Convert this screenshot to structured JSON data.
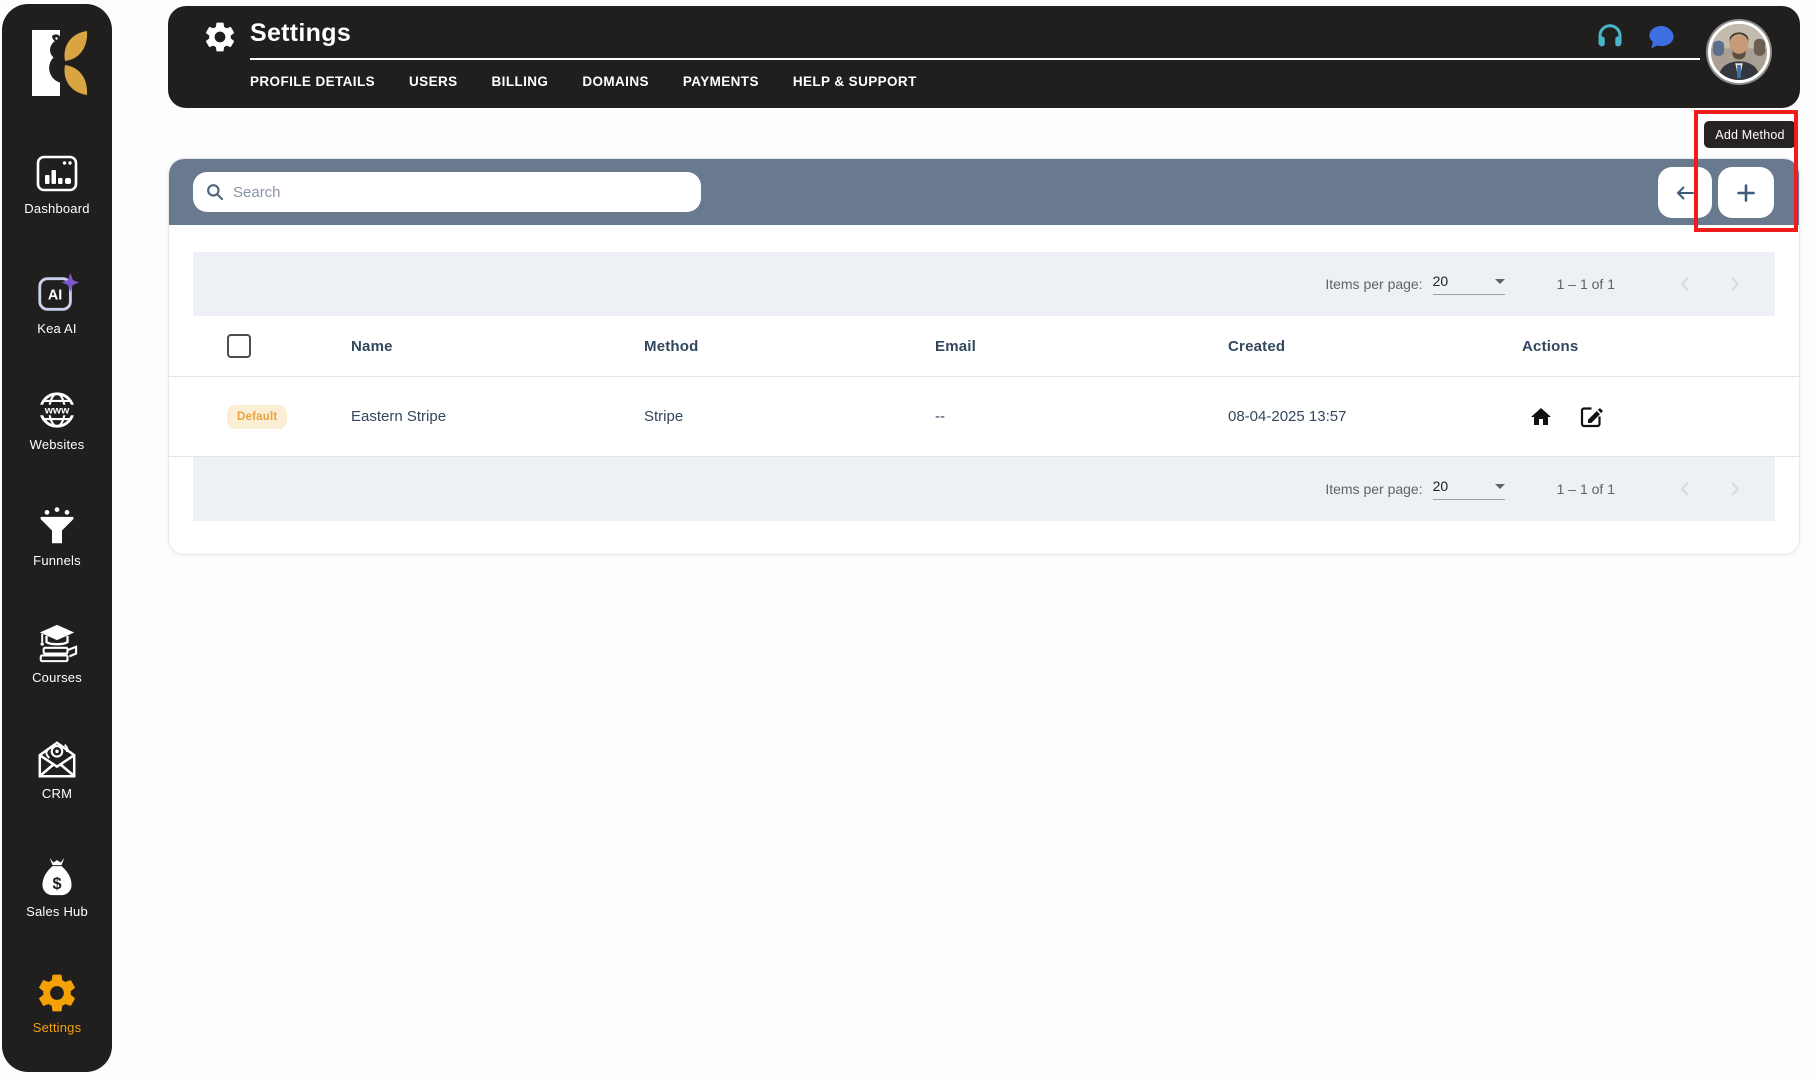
{
  "sidebar": {
    "items": [
      {
        "label": "Dashboard",
        "icon": "dashboard-icon",
        "active": false
      },
      {
        "label": "Kea AI",
        "icon": "kea-ai-icon",
        "active": false
      },
      {
        "label": "Websites",
        "icon": "websites-icon",
        "active": false
      },
      {
        "label": "Funnels",
        "icon": "funnels-icon",
        "active": false
      },
      {
        "label": "Courses",
        "icon": "courses-icon",
        "active": false
      },
      {
        "label": "CRM",
        "icon": "crm-icon",
        "active": false
      },
      {
        "label": "Sales Hub",
        "icon": "sales-hub-icon",
        "active": false
      },
      {
        "label": "Settings",
        "icon": "settings-icon",
        "active": true
      }
    ]
  },
  "header": {
    "title": "Settings",
    "tabs": [
      "PROFILE DETAILS",
      "USERS",
      "BILLING",
      "DOMAINS",
      "PAYMENTS",
      "HELP & SUPPORT"
    ]
  },
  "annotation": {
    "tooltip_label": "Add Method"
  },
  "toolbar": {
    "search_placeholder": "Search"
  },
  "table": {
    "columns": {
      "name": "Name",
      "method": "Method",
      "email": "Email",
      "created": "Created",
      "actions": "Actions"
    },
    "row": {
      "badge": "Default",
      "name": "Eastern Stripe",
      "method": "Stripe",
      "email": "--",
      "created": "08-04-2025 13:57"
    }
  },
  "pagination": {
    "items_per_page_label": "Items per page:",
    "page_size": "20",
    "range": "1 – 1 of 1"
  },
  "colors": {
    "sidebar_dark": "#211E1E",
    "accent_orange": "#F5A106",
    "toolbar_slate": "#6A7A8E",
    "annotation_red": "#EE1C1C",
    "badge_bg": "#FAEFD4",
    "badge_text": "#E8A33D",
    "link_navy": "#2D4E77",
    "headset_teal": "#4AB5C8",
    "chat_blue": "#3D6FE2",
    "logo_gold": "#D9A542"
  }
}
